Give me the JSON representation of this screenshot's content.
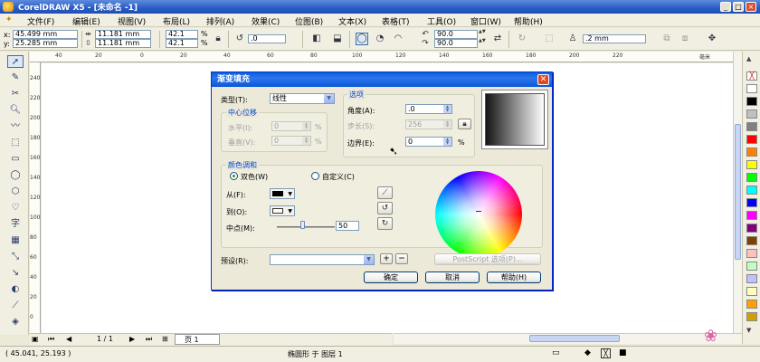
{
  "window": {
    "title": "CorelDRAW X5 - [未命名 -1]",
    "min": "_",
    "max": "□",
    "close": "×"
  },
  "menu": [
    "文件(F)",
    "编辑(E)",
    "视图(V)",
    "布局(L)",
    "排列(A)",
    "效果(C)",
    "位图(B)",
    "文本(X)",
    "表格(T)",
    "工具(O)",
    "窗口(W)",
    "帮助(H)"
  ],
  "propbar": {
    "x_label": "x:",
    "x_value": "45.499 mm",
    "y_label": "y:",
    "y_value": "25.285 mm",
    "w_value": "11.181 mm",
    "h_value": "11.181 mm",
    "scale_x": "42.1",
    "scale_y": "42.1",
    "pct": "%",
    "rotation": ".0",
    "start_angle": "90.0",
    "end_angle": "90.0",
    "outline": ".2 mm"
  },
  "rulers": {
    "top": [
      "40",
      "20",
      "0",
      "20",
      "40",
      "60",
      "80",
      "100",
      "120",
      "140",
      "160",
      "180",
      "200",
      "220"
    ],
    "left": [
      "240",
      "220",
      "200",
      "180",
      "160",
      "140",
      "120",
      "100",
      "80",
      "60",
      "40",
      "20",
      "0"
    ],
    "unit": "毫米"
  },
  "dialog": {
    "title": "渐变填充",
    "type_label": "类型(T):",
    "type_value": "线性",
    "center_group": "中心位移",
    "horizontal_label": "水平(I):",
    "horizontal_value": "0",
    "vertical_label": "垂直(V):",
    "vertical_value": "0",
    "pct": "%",
    "options_group": "选项",
    "angle_label": "角度(A):",
    "angle_value": ".0",
    "steps_label": "步长(S):",
    "steps_value": "256",
    "edge_label": "边界(E):",
    "edge_value": "0",
    "color_group": "颜色调和",
    "two_color": "双色(W)",
    "custom": "自定义(C)",
    "from_label": "从(F):",
    "to_label": "到(O):",
    "mid_label": "中点(M):",
    "mid_value": "50",
    "presets_label": "预设(R):",
    "presets_value": "",
    "postscript": "PostScript 选项(P)...",
    "ok": "确定",
    "cancel": "取消",
    "help": "帮助(H)",
    "from_color": "#000000",
    "to_color": "#ffffff"
  },
  "pagebar": {
    "page_of": "1 / 1",
    "tab": "页 1"
  },
  "status": {
    "coords": "( 45.041, 25.193 )",
    "info": "椭圆形 于 图层 1"
  },
  "palette": [
    "#ffffff",
    "#000000",
    "#c0c0c0",
    "#808080",
    "#ff0000",
    "#ff8000",
    "#ffff00",
    "#00ff00",
    "#00ffff",
    "#0000ff",
    "#ff00ff",
    "#800080",
    "#804000",
    "#ffc0c0",
    "#c0ffc0",
    "#c0c0ff",
    "#ffffc0",
    "#ffa000",
    "#d0a000",
    "#ff6060",
    "#e0e0e0",
    "#b0b0b0"
  ]
}
